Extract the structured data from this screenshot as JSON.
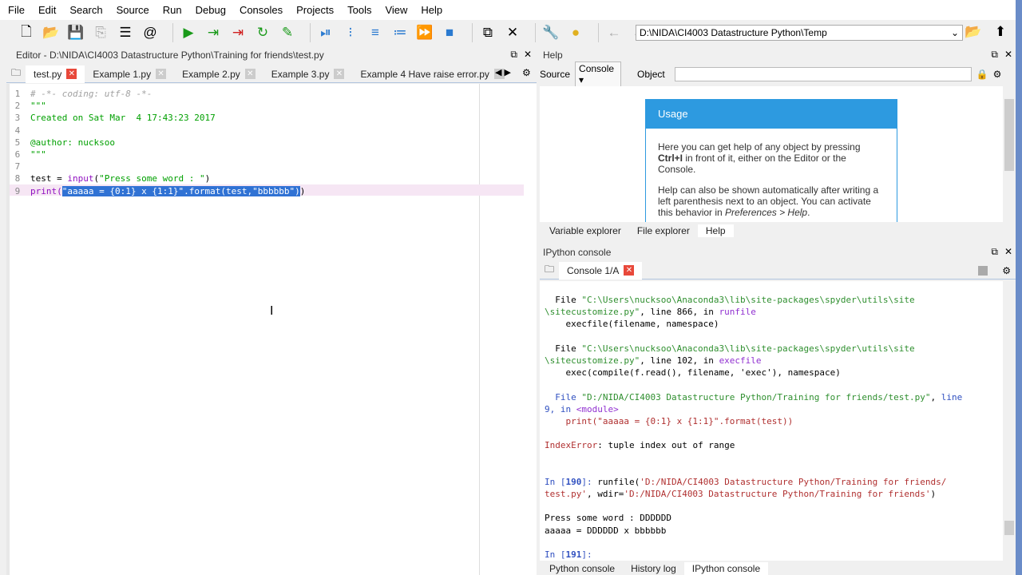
{
  "menu": [
    "File",
    "Edit",
    "Search",
    "Source",
    "Run",
    "Debug",
    "Consoles",
    "Projects",
    "Tools",
    "View",
    "Help"
  ],
  "toolbar": {
    "path": "D:\\NIDA\\CI4003 Datastructure Python\\Temp"
  },
  "editor": {
    "title": "Editor - D:\\NIDA\\CI4003 Datastructure Python\\Training for friends\\test.py",
    "tabs": [
      "test.py",
      "Example 1.py",
      "Example 2.py",
      "Example 3.py",
      "Example 4 Have raise error.py"
    ],
    "lines": [
      [
        [
          "cmt",
          "# -*- coding: utf-8 -*-"
        ]
      ],
      [
        [
          "str",
          "\"\"\""
        ]
      ],
      [
        [
          "str",
          "Created on Sat Mar  4 17:43:23 2017"
        ]
      ],
      [],
      [
        [
          "str",
          "@author: nucksoo"
        ]
      ],
      [
        [
          "str",
          "\"\"\""
        ]
      ],
      [],
      [
        [
          "def",
          "test = "
        ],
        [
          "kw",
          "input"
        ],
        [
          "def",
          "("
        ],
        [
          "str",
          "\"Press some word : \""
        ],
        [
          "def",
          ")"
        ]
      ],
      [
        [
          "kw",
          "print("
        ],
        [
          "sel",
          "\"aaaaa = {0:1} x {1:1}\".format(test,\"bbbbbb\")"
        ],
        [
          "def",
          ")"
        ]
      ]
    ]
  },
  "help": {
    "title": "Help",
    "source_label": "Source",
    "source_value": "Console",
    "object_label": "Object",
    "usage_title": "Usage",
    "p1a": "Here you can get help of any object by pressing ",
    "p1b": "Ctrl+I",
    "p1c": " in front of it, either on the Editor or the Console.",
    "p2a": "Help can also be shown automatically after writing a left parenthesis next to an object. You can activate this behavior in ",
    "p2b": "Preferences > Help",
    "p2c": ".",
    "tabs": [
      "Variable explorer",
      "File explorer",
      "Help"
    ]
  },
  "console": {
    "title": "IPython console",
    "tab": "Console 1/A",
    "lines": [
      [
        [
          "def",
          "  File "
        ],
        [
          "cstr",
          "\"C:\\Users\\nucksoo\\Anaconda3\\lib\\site-packages\\spyder\\utils\\site"
        ]
      ],
      [
        [
          "cstr",
          "\\sitecustomize.py\""
        ],
        [
          "def",
          ", line 866, in "
        ],
        [
          "cfn",
          "runfile"
        ]
      ],
      [
        [
          "def",
          "    execfile(filename, namespace)"
        ]
      ],
      [],
      [
        [
          "def",
          "  File "
        ],
        [
          "cstr",
          "\"C:\\Users\\nucksoo\\Anaconda3\\lib\\site-packages\\spyder\\utils\\site"
        ]
      ],
      [
        [
          "cstr",
          "\\sitecustomize.py\""
        ],
        [
          "def",
          ", line 102, in "
        ],
        [
          "cfn",
          "execfile"
        ]
      ],
      [
        [
          "def",
          "    exec(compile(f.read(), filename, 'exec'), namespace)"
        ]
      ],
      [],
      [
        [
          "cprm",
          "  File "
        ],
        [
          "cstr",
          "\"D:/NIDA/CI4003 Datastructure Python/Training for friends/test.py\""
        ],
        [
          "def",
          ", "
        ],
        [
          "cprm",
          "line"
        ]
      ],
      [
        [
          "cprm",
          "9, in "
        ],
        [
          "cfn",
          "<module>"
        ]
      ],
      [
        [
          "cerr",
          "    print(\"aaaaa = {0:1} x {1:1}\".format(test))"
        ]
      ],
      [],
      [
        [
          "cerr",
          "IndexError"
        ],
        [
          "def",
          ": tuple index out of range"
        ]
      ],
      [],
      [],
      [
        [
          "cprm",
          "In ["
        ],
        [
          "cnum",
          "190"
        ],
        [
          "cprm",
          "]: "
        ],
        [
          "def",
          "runfile("
        ],
        [
          "carg",
          "'D:/NIDA/CI4003 Datastructure Python/Training for friends/"
        ]
      ],
      [
        [
          "carg",
          "test.py'"
        ],
        [
          "def",
          ", wdir="
        ],
        [
          "carg",
          "'D:/NIDA/CI4003 Datastructure Python/Training for friends'"
        ],
        [
          "def",
          ")"
        ]
      ],
      [],
      [
        [
          "def",
          "Press some word : DDDDDD"
        ]
      ],
      [
        [
          "def",
          "aaaaa = DDDDDD x bbbbbb"
        ]
      ],
      [],
      [
        [
          "cprm",
          "In ["
        ],
        [
          "cnum",
          "191"
        ],
        [
          "cprm",
          "]: "
        ]
      ]
    ],
    "tabs": [
      "Python console",
      "History log",
      "IPython console"
    ]
  }
}
